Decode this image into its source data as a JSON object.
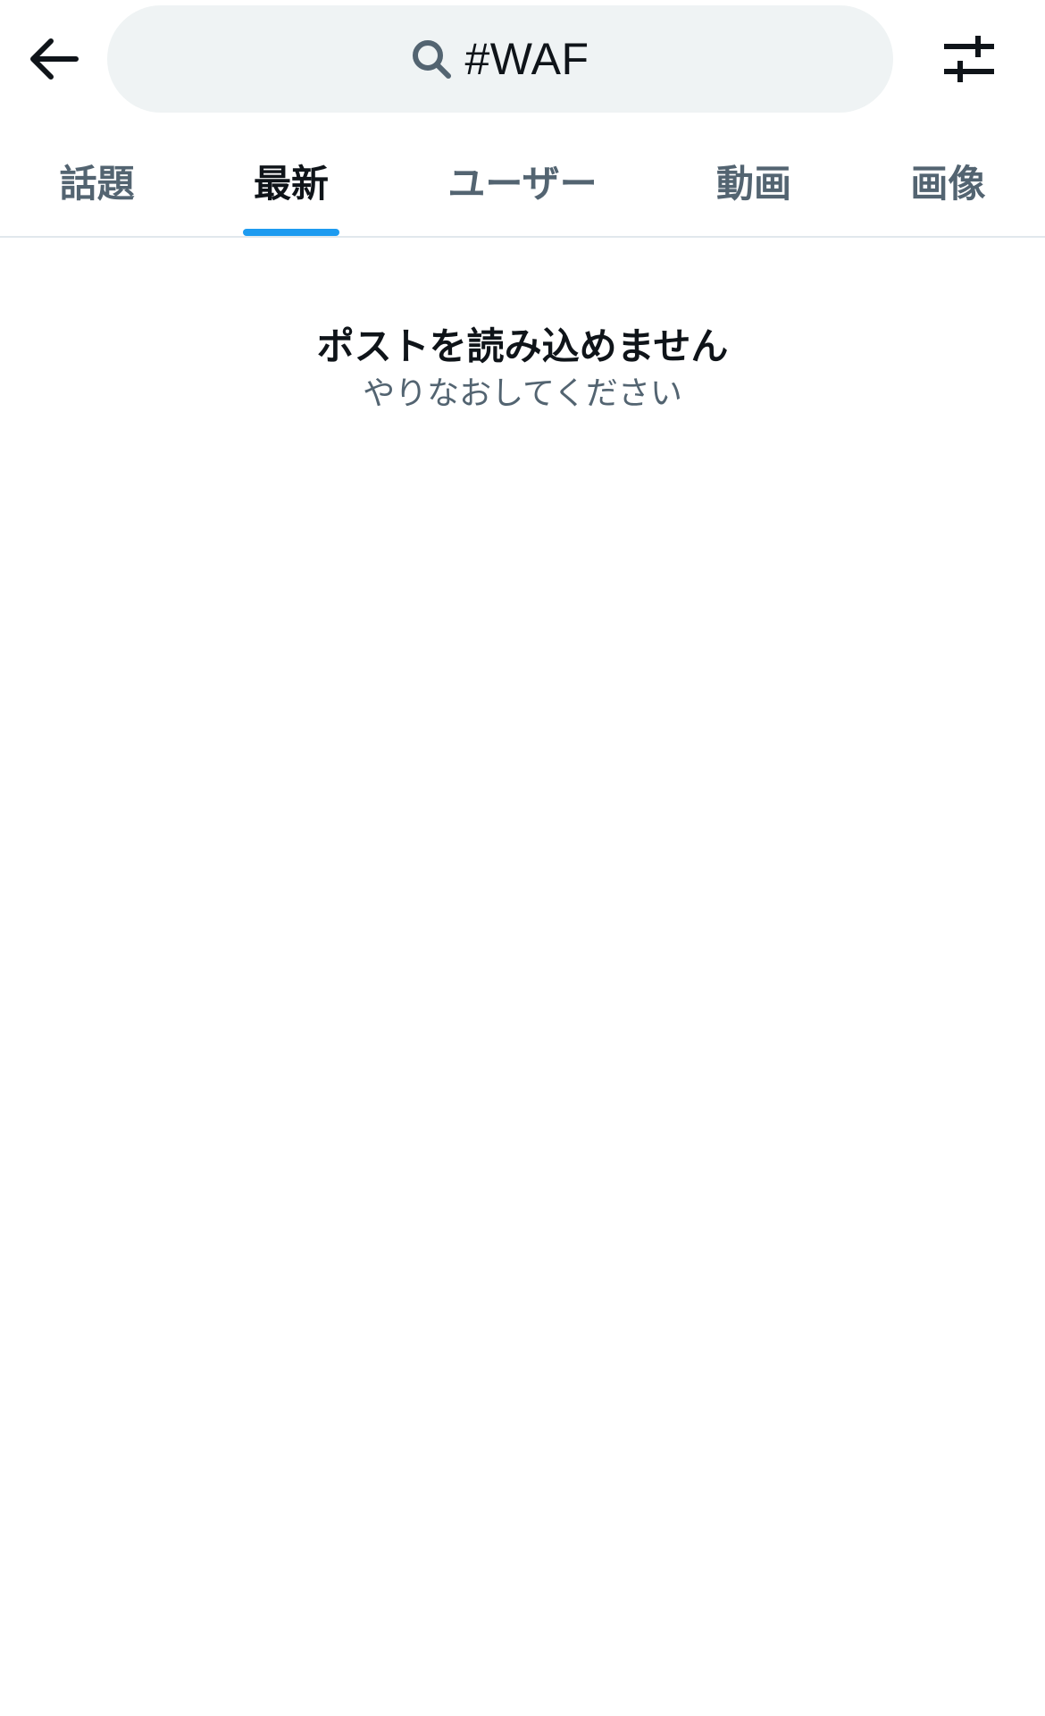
{
  "header": {
    "back_icon": "arrow-left-icon",
    "search": {
      "icon": "search-icon",
      "value": "#WAF"
    },
    "filter_icon": "sliders-icon"
  },
  "tabs": [
    {
      "label": "話題",
      "active": false
    },
    {
      "label": "最新",
      "active": true
    },
    {
      "label": "ユーザー",
      "active": false
    },
    {
      "label": "動画",
      "active": false
    },
    {
      "label": "画像",
      "active": false
    }
  ],
  "message": {
    "title": "ポストを読み込めません",
    "subtitle": "やりなおしてください"
  },
  "colors": {
    "accent": "#1d9bf0",
    "search_bg": "#eff3f4",
    "text_primary": "#0f1419",
    "text_secondary": "#536471",
    "divider": "#e1e8ed"
  }
}
